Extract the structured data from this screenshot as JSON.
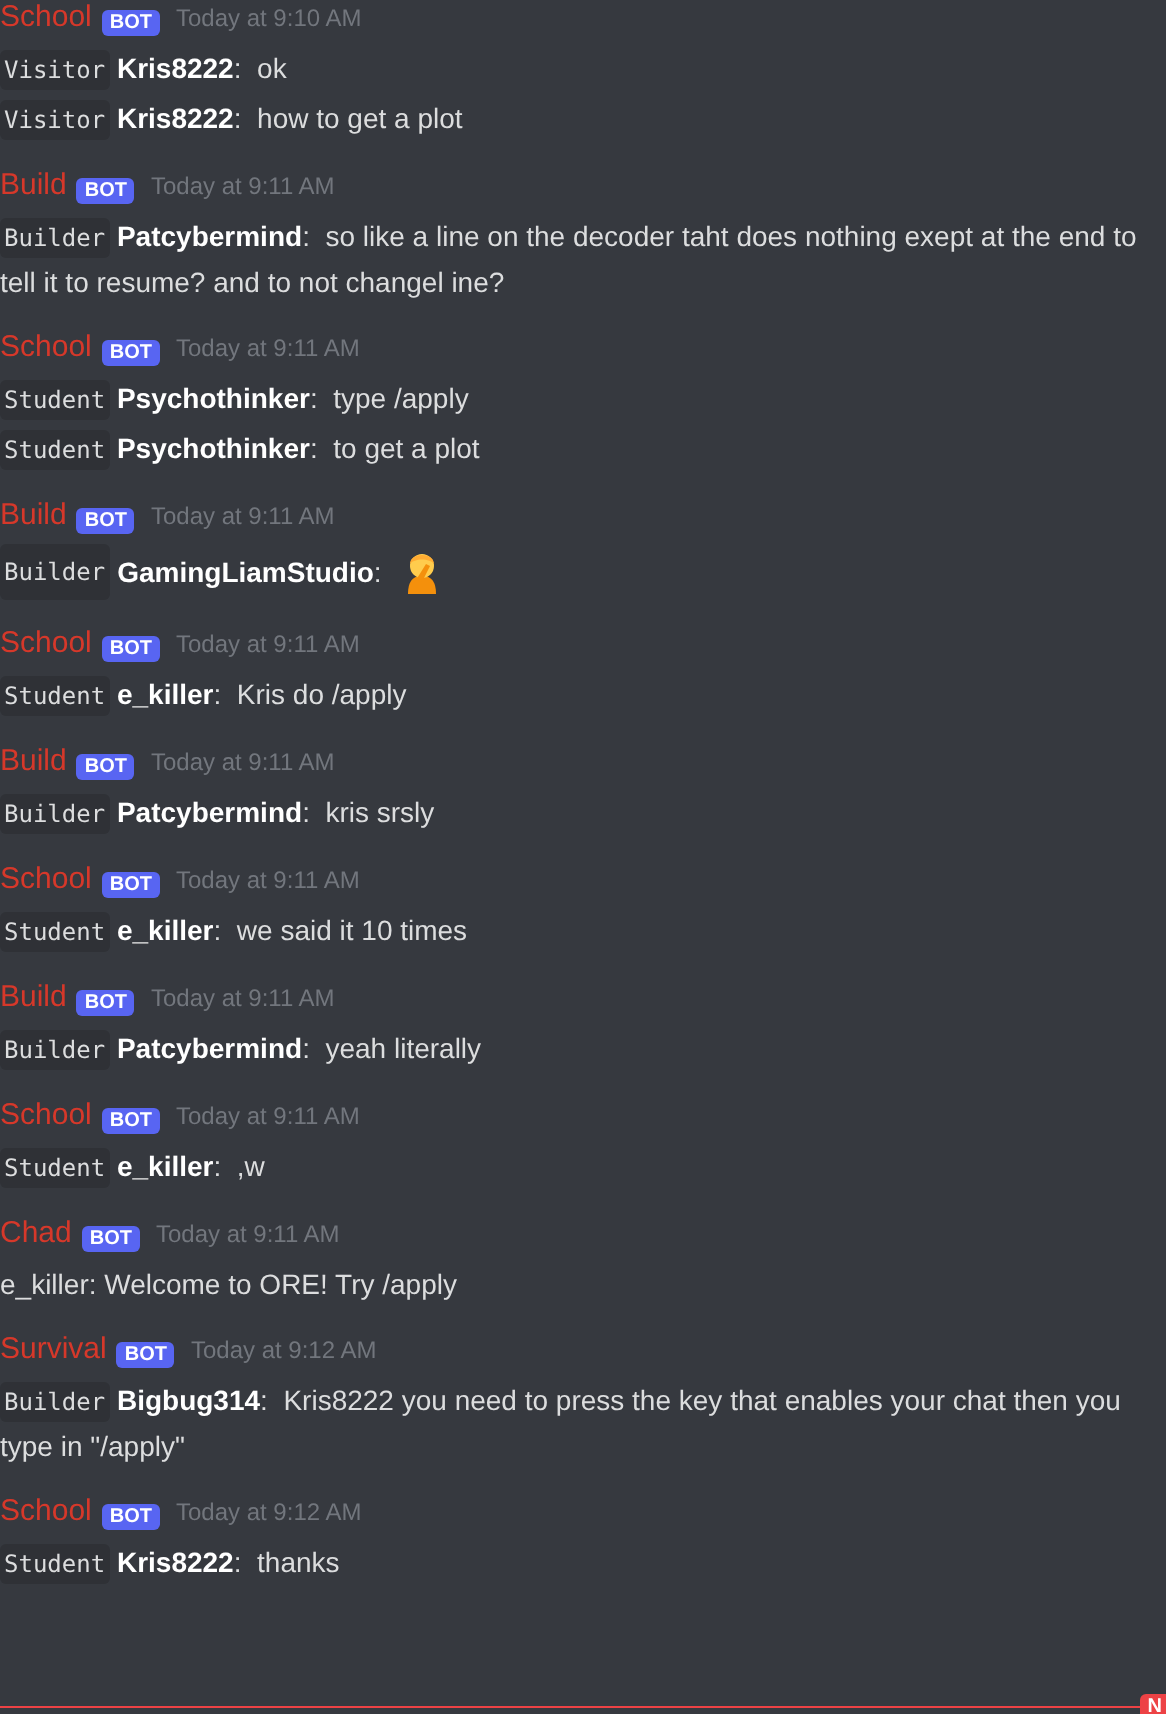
{
  "messages": [
    {
      "bot": "School",
      "badge": "BOT",
      "time": "Today at 9:10 AM",
      "lines": [
        {
          "kind": "chat",
          "rank": "Visitor",
          "user": "Kris8222",
          "text": ":  ok"
        },
        {
          "kind": "chat",
          "rank": "Visitor",
          "user": "Kris8222",
          "text": ":  how to get a plot"
        }
      ]
    },
    {
      "bot": "Build",
      "badge": "BOT",
      "time": "Today at 9:11 AM",
      "lines": [
        {
          "kind": "chat",
          "rank": "Builder",
          "user": "Patcybermind",
          "text": ":  so like a line on the decoder taht does nothing exept at the end to tell it to resume? and to not changel ine?"
        }
      ]
    },
    {
      "bot": "School",
      "badge": "BOT",
      "time": "Today at 9:11 AM",
      "lines": [
        {
          "kind": "chat",
          "rank": "Student",
          "user": "Psychothinker",
          "text": ":  type /apply"
        },
        {
          "kind": "chat",
          "rank": "Student",
          "user": "Psychothinker",
          "text": ":  to get a plot"
        }
      ]
    },
    {
      "bot": "Build",
      "badge": "BOT",
      "time": "Today at 9:11 AM",
      "lines": [
        {
          "kind": "emoji",
          "rank": "Builder",
          "user": "GamingLiamStudio",
          "text": ":"
        }
      ]
    },
    {
      "bot": "School",
      "badge": "BOT",
      "time": "Today at 9:11 AM",
      "lines": [
        {
          "kind": "chat",
          "rank": "Student",
          "user": "e_killer",
          "text": ":  Kris do /apply"
        }
      ]
    },
    {
      "bot": "Build",
      "badge": "BOT",
      "time": "Today at 9:11 AM",
      "lines": [
        {
          "kind": "chat",
          "rank": "Builder",
          "user": "Patcybermind",
          "text": ":  kris srsly"
        }
      ]
    },
    {
      "bot": "School",
      "badge": "BOT",
      "time": "Today at 9:11 AM",
      "lines": [
        {
          "kind": "chat",
          "rank": "Student",
          "user": "e_killer",
          "text": ":  we said it 10 times"
        }
      ]
    },
    {
      "bot": "Build",
      "badge": "BOT",
      "time": "Today at 9:11 AM",
      "lines": [
        {
          "kind": "chat",
          "rank": "Builder",
          "user": "Patcybermind",
          "text": ":  yeah literally"
        }
      ]
    },
    {
      "bot": "School",
      "badge": "BOT",
      "time": "Today at 9:11 AM",
      "lines": [
        {
          "kind": "chat",
          "rank": "Student",
          "user": "e_killer",
          "text": ":  ,w"
        }
      ]
    },
    {
      "bot": "Chad",
      "badge": "BOT",
      "time": "Today at 9:11 AM",
      "lines": [
        {
          "kind": "plain",
          "text": "e_killer: Welcome to ORE! Try /apply"
        }
      ]
    },
    {
      "bot": "Survival",
      "badge": "BOT",
      "time": "Today at 9:12 AM",
      "lines": [
        {
          "kind": "chat",
          "rank": "Builder",
          "user": "Bigbug314",
          "text": ":  Kris8222 you need to press the key that enables your chat then you type in \"/apply\""
        }
      ]
    },
    {
      "bot": "School",
      "badge": "BOT",
      "time": "Today at 9:12 AM",
      "lines": [
        {
          "kind": "chat",
          "rank": "Student",
          "user": "Kris8222",
          "text": ":  thanks"
        }
      ]
    }
  ],
  "new_divider": {
    "label": "N"
  }
}
